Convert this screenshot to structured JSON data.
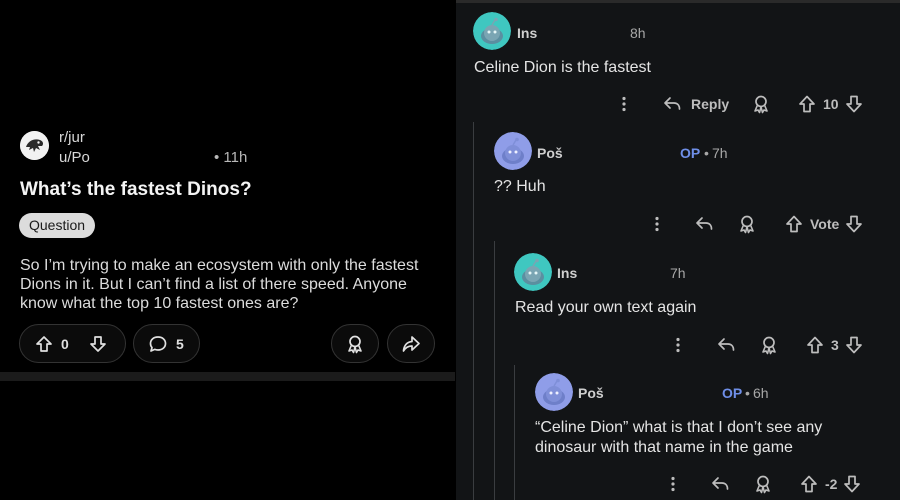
{
  "post": {
    "subreddit": "r/jur",
    "username": "u/Po",
    "time": "• 11h",
    "title": "What’s the fastest Dinos?",
    "flair": "Question",
    "body": "So I’m trying to make an ecosystem with only the fastest Dions in it. But I can’t find a list of there speed. Anyone know what the top 10 fastest ones are?",
    "vote_count": "0",
    "comment_count": "5"
  },
  "comments": [
    {
      "username": "Ins",
      "time": "8h",
      "text": "Celine Dion is the fastest",
      "reply_label": "Reply",
      "vote_count": "10",
      "avatar_color": "#3fc7c0"
    },
    {
      "username": "Poš",
      "op_label": "OP",
      "dot": "•",
      "time": "7h",
      "text": "?? Huh",
      "vote_count": "Vote",
      "avatar_color": "#8f9de8"
    },
    {
      "username": "Ins",
      "time": "7h",
      "text": "Read your own text again",
      "vote_count": "3",
      "avatar_color": "#3fc7c0"
    },
    {
      "username": "Poš",
      "op_label": "OP",
      "dot": "•",
      "time": "6h",
      "text": "“Celine Dion” what is that I don’t see any dinosaur with that name in the game",
      "vote_count": "-2",
      "avatar_color": "#8f9de8"
    }
  ],
  "colors": {
    "background": "#000000",
    "comments_background": "#121416",
    "op_accent": "#6f8fe8",
    "flair_background": "#dcdcdc"
  },
  "icons": {
    "upvote": "arrow-up-icon",
    "downvote": "arrow-down-icon",
    "comment": "speech-bubble-icon",
    "award": "award-icon",
    "share": "share-arrow-icon",
    "reply": "reply-arrow-icon",
    "more": "more-vertical-icon"
  }
}
